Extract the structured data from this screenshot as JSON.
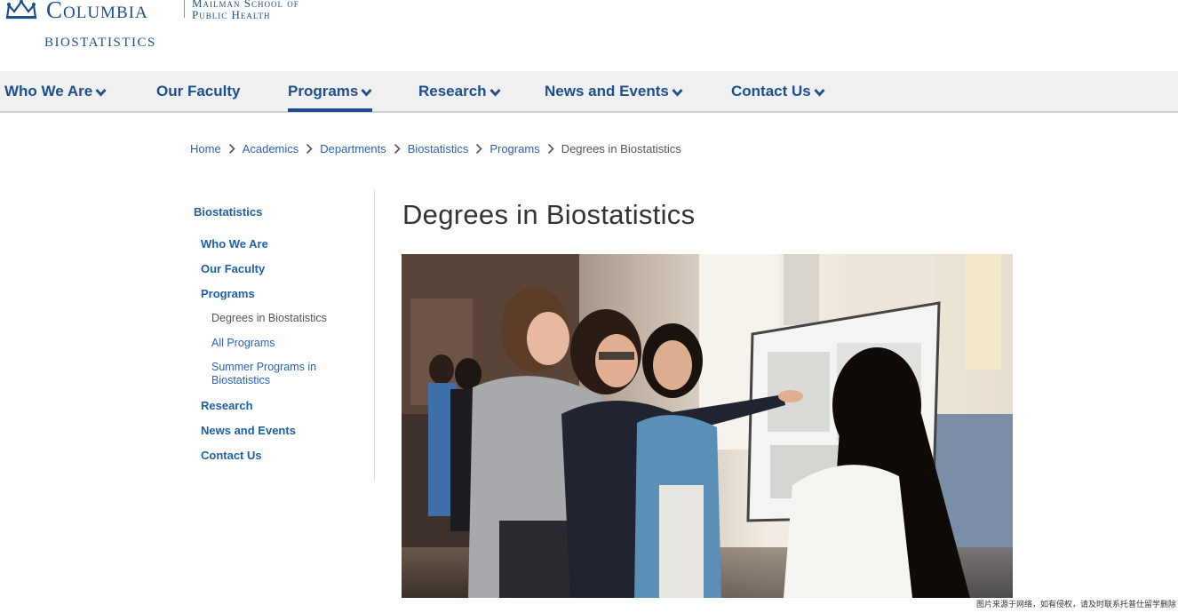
{
  "logo": {
    "name": "Columbia",
    "school": "Mailman School of Public Health",
    "department": "BIOSTATISTICS"
  },
  "nav": {
    "items": [
      {
        "label": "Who We Are",
        "dropdown": true
      },
      {
        "label": "Our Faculty",
        "dropdown": false
      },
      {
        "label": "Programs",
        "dropdown": true,
        "active": true
      },
      {
        "label": "Research",
        "dropdown": true
      },
      {
        "label": "News and Events",
        "dropdown": true
      },
      {
        "label": "Contact Us",
        "dropdown": true
      }
    ]
  },
  "breadcrumb": [
    "Home",
    "Academics",
    "Departments",
    "Biostatistics",
    "Programs",
    "Degrees in Biostatistics"
  ],
  "sidebar": {
    "title": "Biostatistics",
    "items": [
      "Who We Are",
      "Our Faculty",
      "Programs"
    ],
    "sub_items": [
      "Degrees in Biostatistics",
      "All Programs",
      "Summer Programs in Biostatistics"
    ],
    "more_items": [
      "Research",
      "News and Events",
      "Contact Us"
    ]
  },
  "main": {
    "title": "Degrees in Biostatistics"
  },
  "watermark": "图片来源于网络，如有侵权，请及时联系托普仕留学删除",
  "colors": {
    "brand": "#1f4e8c",
    "link": "#2a62b8",
    "navbar_bg": "#f0f0f0"
  }
}
